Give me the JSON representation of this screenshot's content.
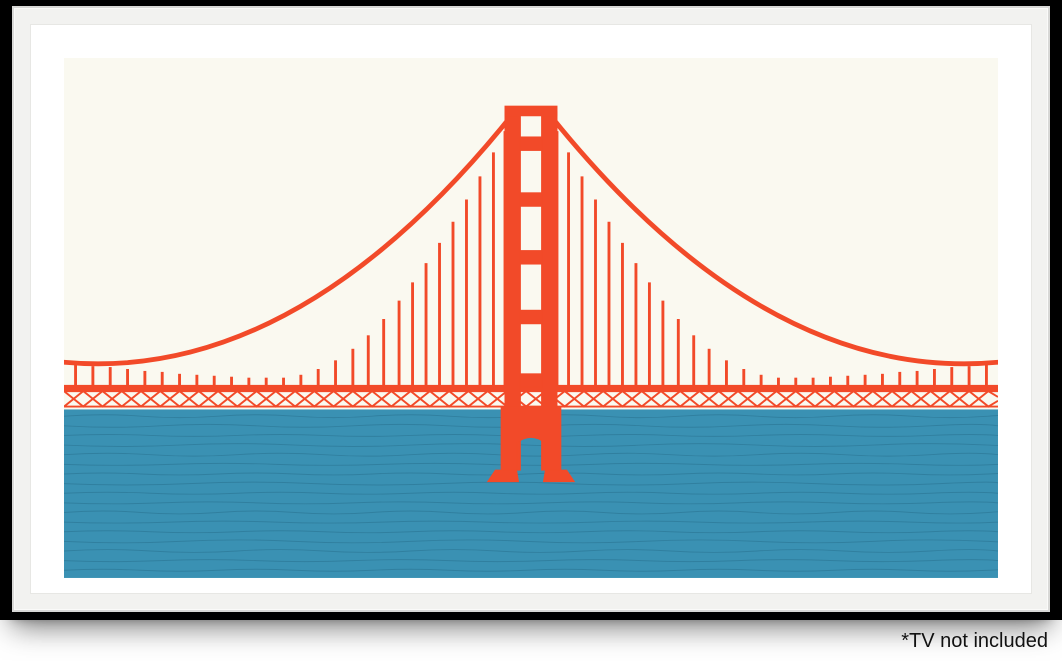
{
  "artwork": {
    "description": "Golden Gate Bridge illustration",
    "colors": {
      "sky": "#faf9f0",
      "bridge": "#f24a29",
      "water": "#3a91b3",
      "water_line": "#2f7d9c"
    }
  },
  "disclaimer": "*TV not included"
}
